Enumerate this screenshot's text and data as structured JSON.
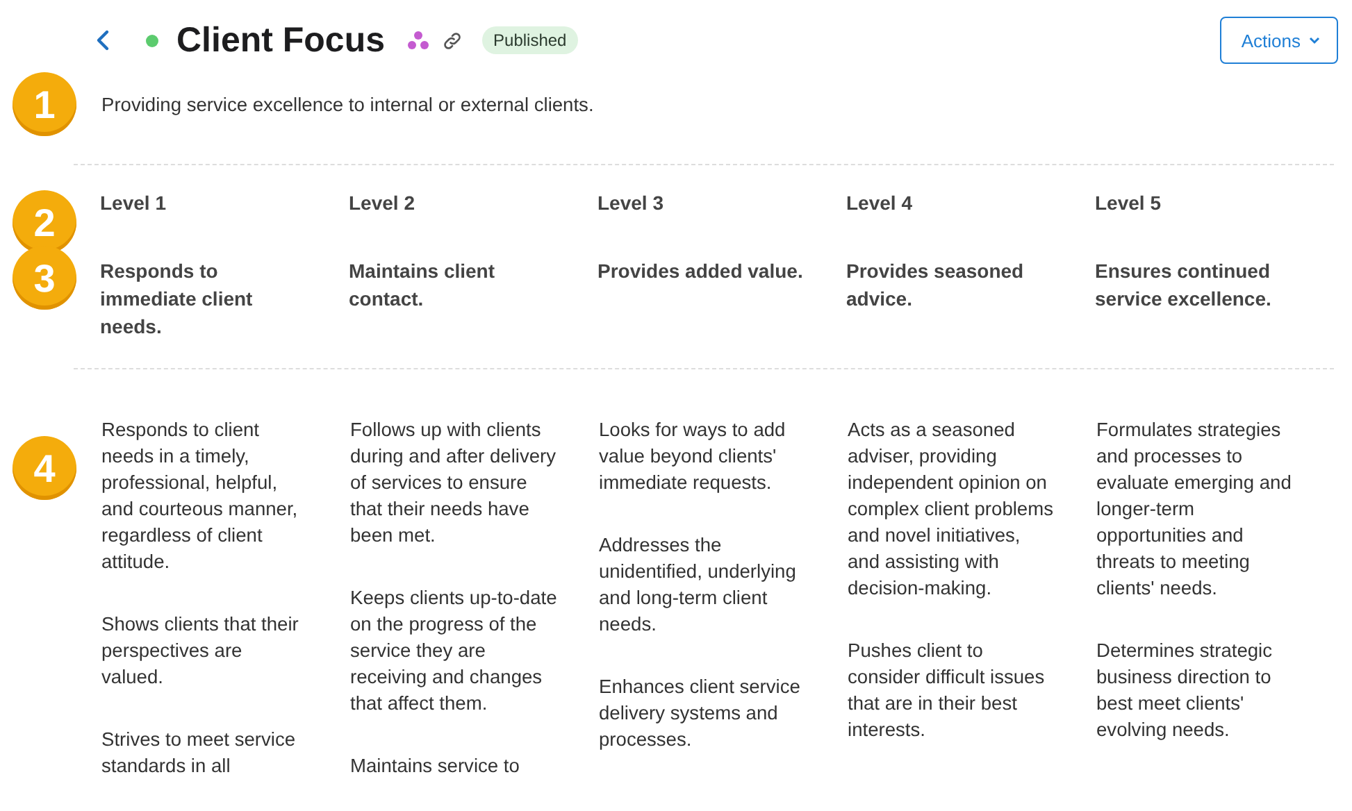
{
  "header": {
    "title": "Client Focus",
    "status": "Published",
    "action": "Actions"
  },
  "description": "Providing service excellence to internal or external clients.",
  "markers": [
    "1",
    "2",
    "3",
    "4"
  ],
  "levels": [
    {
      "label": "Level 1",
      "title": "Responds to immediate client needs.",
      "behaviors": [
        "Responds to client needs in a timely, professional, helpful, and courteous manner, regardless of client attitude.",
        "Shows clients that their perspectives are valued.",
        "Strives to meet service standards in all"
      ]
    },
    {
      "label": "Level 2",
      "title": "Maintains client contact.",
      "behaviors": [
        "Follows up with clients during and after delivery of services to ensure that their needs have been met.",
        "Keeps clients up-to-date on the progress of the service they are receiving and changes that affect them.",
        "Maintains service to"
      ]
    },
    {
      "label": "Level 3",
      "title": "Provides added value.",
      "behaviors": [
        "Looks for ways to add value beyond clients' immediate requests.",
        "Addresses the unidentified, underlying and long-term client needs.",
        "Enhances client service delivery systems and processes."
      ]
    },
    {
      "label": "Level 4",
      "title": "Provides seasoned advice.",
      "behaviors": [
        "Acts as a seasoned adviser, providing independent opinion on complex client problems and novel initiatives, and assisting with decision-making.",
        "Pushes client to consider difficult issues that are in their best interests."
      ]
    },
    {
      "label": "Level 5",
      "title": "Ensures continued service excellence.",
      "behaviors": [
        "Formulates strategies and processes to evaluate emerging and longer-term opportunities and threats to meeting clients' needs.",
        "Determines strategic business direction to best meet clients' evolving needs."
      ]
    }
  ]
}
